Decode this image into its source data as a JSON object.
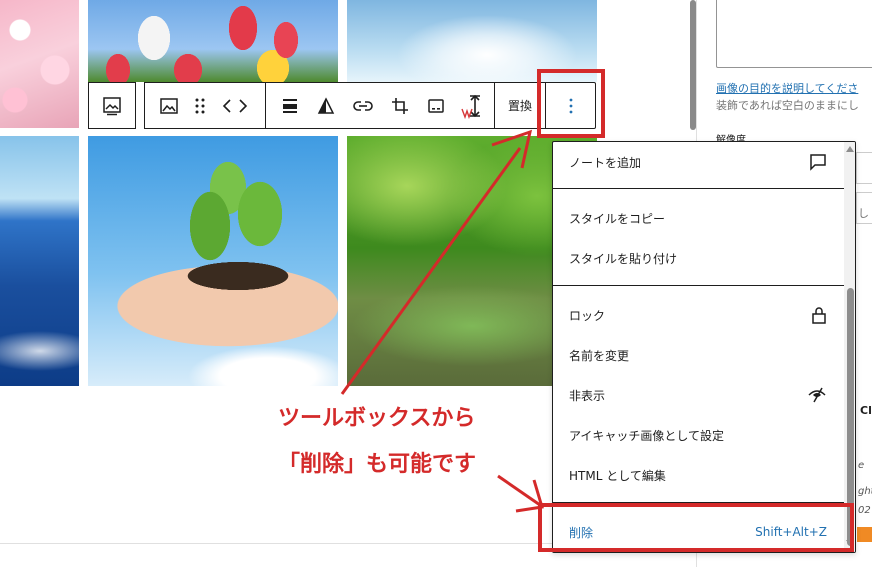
{
  "sidebar": {
    "alt_help_link": "画像の目的を説明してくださ",
    "alt_help_note": "装飾であれば空白のままにし",
    "resolution_label": "解像度",
    "frag_1": "Cl",
    "frag_2": "e",
    "frag_3": "ght",
    "frag_4": "02",
    "frag_5": "し"
  },
  "toolbar": {
    "replace_label": "置換",
    "options_glyph": "⋮"
  },
  "menu": {
    "items": [
      {
        "label": "ノートを追加",
        "icon": "comment-icon"
      },
      {
        "label": "スタイルをコピー"
      },
      {
        "label": "スタイルを貼り付け"
      },
      {
        "label": "ロック",
        "icon": "lock-icon"
      },
      {
        "label": "名前を変更"
      },
      {
        "label": "非表示",
        "icon": "hidden-eye-icon"
      },
      {
        "label": "アイキャッチ画像として設定"
      },
      {
        "label": "HTML として編集"
      },
      {
        "label": "削除",
        "shortcut": "Shift+Alt+Z"
      }
    ]
  },
  "annotation": {
    "line1": "ツールボックスから",
    "line2": "「削除」も可能です",
    "color": "#d42a2a"
  },
  "colors": {
    "accent": "#2271b1",
    "border": "#1e1e1e"
  }
}
